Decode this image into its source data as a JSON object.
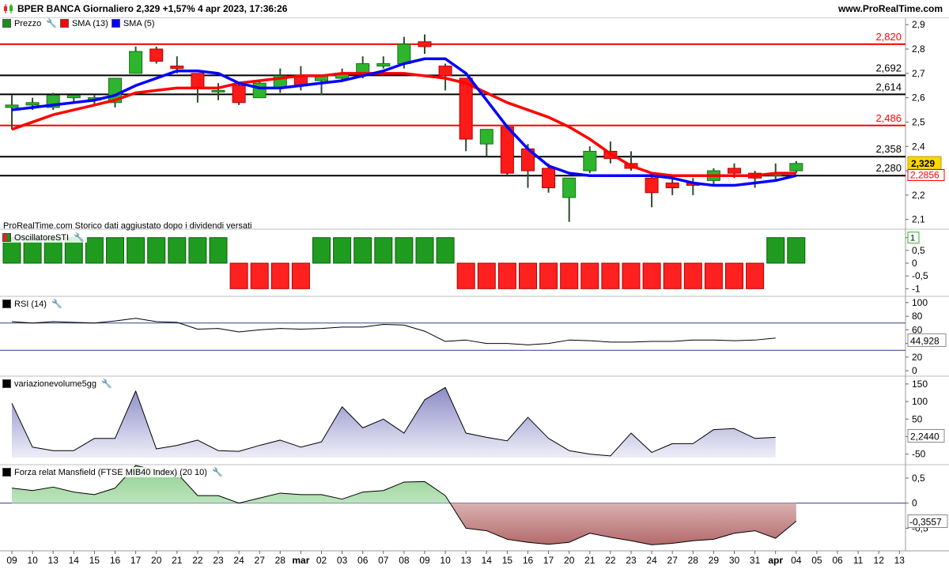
{
  "header": {
    "title": "BPER BANCA Giornaliero 2,329 +1,57% 4 apr 2023, 17:36:26",
    "site": "www.ProRealTime.com"
  },
  "price_panel": {
    "legend": [
      {
        "label": "Prezzo",
        "color": "#1a8f1a"
      },
      {
        "label": "SMA (13)",
        "color": "#ff0000"
      },
      {
        "label": "SMA (5)",
        "color": "#0000ff"
      }
    ],
    "note": "ProRealTime.com Storico dati aggiustato dopo i dividendi versati",
    "y_ticks": [
      "2,9",
      "2,8",
      "2,7",
      "2,6",
      "2,5",
      "2,4",
      "2,3",
      "2,2",
      "2,1"
    ],
    "y_tick_values": [
      2.9,
      2.8,
      2.7,
      2.6,
      2.5,
      2.4,
      2.3,
      2.2,
      2.1
    ],
    "hlines": [
      {
        "value": 2.82,
        "label": "2,820",
        "color": "#ff0000"
      },
      {
        "value": 2.692,
        "label": "2,692",
        "color": "#000000"
      },
      {
        "value": 2.614,
        "label": "2,614",
        "color": "#000000"
      },
      {
        "value": 2.486,
        "label": "2,486",
        "color": "#ff0000"
      },
      {
        "value": 2.358,
        "label": "2,358",
        "color": "#000000"
      },
      {
        "value": 2.28,
        "label": "2,280",
        "color": "#000000"
      }
    ],
    "last_price": "2,329",
    "sma13_last": "2,2856"
  },
  "sti_panel": {
    "label": "OscillatoreSTI",
    "y_ticks": [
      "1",
      "0,5",
      "0",
      "-0,5",
      "-1"
    ],
    "values": [
      1,
      1,
      1,
      1,
      1,
      1,
      1,
      1,
      1,
      1,
      1,
      -1,
      -1,
      -1,
      -1,
      1,
      1,
      1,
      1,
      1,
      1,
      1,
      -1,
      -1,
      -1,
      -1,
      -1,
      -1,
      -1,
      -1,
      -1,
      -1,
      -1,
      -1,
      -1,
      -1,
      -1,
      1,
      1
    ],
    "last": "1"
  },
  "rsi_panel": {
    "label": "RSI (14)",
    "y_ticks": [
      "100",
      "80",
      "60",
      "40",
      "20",
      "0"
    ],
    "values": [
      72,
      70,
      72,
      71,
      70,
      73,
      77,
      72,
      71,
      61,
      62,
      57,
      60,
      62,
      61,
      62,
      64,
      64,
      68,
      67,
      58,
      43,
      45,
      40,
      40,
      38,
      40,
      45,
      44,
      42,
      42,
      43,
      43,
      45,
      45,
      44,
      45,
      48
    ],
    "last": "44,928"
  },
  "vol_panel": {
    "label": "variazionevolume5gg",
    "y_ticks": [
      "150",
      "100",
      "50",
      "0",
      "-50"
    ],
    "values": [
      95,
      -30,
      -40,
      -40,
      -5,
      -5,
      130,
      -35,
      -25,
      -10,
      -40,
      -42,
      -25,
      -10,
      -30,
      -15,
      85,
      25,
      50,
      10,
      105,
      140,
      10,
      -2,
      -12,
      55,
      -5,
      -40,
      -50,
      -55,
      10,
      -45,
      -20,
      -20,
      20,
      23,
      -5,
      -2
    ],
    "last": "2,2440"
  },
  "mansfield_panel": {
    "label": "Forza relat Mansfield (FTSE MIB40 Index) (20 10)",
    "y_ticks": [
      "0,5",
      "0",
      "-0,5"
    ],
    "values": [
      0.3,
      0.25,
      0.32,
      0.22,
      0.17,
      0.3,
      0.75,
      0.65,
      0.6,
      0.15,
      0.15,
      0.0,
      0.1,
      0.2,
      0.17,
      0.17,
      0.08,
      0.22,
      0.25,
      0.42,
      0.43,
      0.15,
      -0.5,
      -0.55,
      -0.72,
      -0.78,
      -0.82,
      -0.78,
      -0.6,
      -0.68,
      -0.75,
      -0.83,
      -0.8,
      -0.75,
      -0.72,
      -0.6,
      -0.55,
      -0.7,
      -0.36
    ],
    "last": "-0,3557"
  },
  "x_axis": {
    "labels": [
      "09",
      "10",
      "13",
      "14",
      "15",
      "16",
      "17",
      "20",
      "21",
      "22",
      "23",
      "24",
      "27",
      "28",
      "mar",
      "02",
      "03",
      "06",
      "07",
      "08",
      "09",
      "10",
      "13",
      "14",
      "15",
      "16",
      "17",
      "20",
      "21",
      "22",
      "23",
      "24",
      "27",
      "28",
      "29",
      "30",
      "31",
      "apr",
      "04",
      "05",
      "06",
      "11",
      "12",
      "13"
    ],
    "bold": [
      "mar",
      "apr"
    ]
  },
  "candles": [
    {
      "o": 2.56,
      "h": 2.61,
      "l": 2.47,
      "c": 2.57
    },
    {
      "o": 2.57,
      "h": 2.6,
      "l": 2.55,
      "c": 2.58
    },
    {
      "o": 2.56,
      "h": 2.62,
      "l": 2.55,
      "c": 2.61
    },
    {
      "o": 2.6,
      "h": 2.61,
      "l": 2.58,
      "c": 2.61
    },
    {
      "o": 2.59,
      "h": 2.61,
      "l": 2.57,
      "c": 2.6
    },
    {
      "o": 2.58,
      "h": 2.68,
      "l": 2.56,
      "c": 2.68
    },
    {
      "o": 2.7,
      "h": 2.81,
      "l": 2.7,
      "c": 2.79
    },
    {
      "o": 2.8,
      "h": 2.81,
      "l": 2.74,
      "c": 2.75
    },
    {
      "o": 2.73,
      "h": 2.77,
      "l": 2.7,
      "c": 2.72
    },
    {
      "o": 2.7,
      "h": 2.7,
      "l": 2.58,
      "c": 2.64
    },
    {
      "o": 2.63,
      "h": 2.66,
      "l": 2.59,
      "c": 2.63
    },
    {
      "o": 2.65,
      "h": 2.66,
      "l": 2.57,
      "c": 2.58
    },
    {
      "o": 2.6,
      "h": 2.67,
      "l": 2.6,
      "c": 2.66
    },
    {
      "o": 2.64,
      "h": 2.72,
      "l": 2.62,
      "c": 2.69
    },
    {
      "o": 2.69,
      "h": 2.73,
      "l": 2.63,
      "c": 2.65
    },
    {
      "o": 2.67,
      "h": 2.69,
      "l": 2.61,
      "c": 2.69
    },
    {
      "o": 2.68,
      "h": 2.72,
      "l": 2.67,
      "c": 2.7
    },
    {
      "o": 2.7,
      "h": 2.77,
      "l": 2.68,
      "c": 2.74
    },
    {
      "o": 2.73,
      "h": 2.77,
      "l": 2.72,
      "c": 2.74
    },
    {
      "o": 2.74,
      "h": 2.85,
      "l": 2.72,
      "c": 2.82
    },
    {
      "o": 2.83,
      "h": 2.86,
      "l": 2.78,
      "c": 2.81
    },
    {
      "o": 2.73,
      "h": 2.74,
      "l": 2.63,
      "c": 2.69
    },
    {
      "o": 2.68,
      "h": 2.68,
      "l": 2.38,
      "c": 2.43
    },
    {
      "o": 2.41,
      "h": 2.47,
      "l": 2.36,
      "c": 2.47
    },
    {
      "o": 2.48,
      "h": 2.49,
      "l": 2.28,
      "c": 2.29
    },
    {
      "o": 2.39,
      "h": 2.41,
      "l": 2.23,
      "c": 2.3
    },
    {
      "o": 2.31,
      "h": 2.33,
      "l": 2.21,
      "c": 2.23
    },
    {
      "o": 2.19,
      "h": 2.26,
      "l": 2.09,
      "c": 2.27
    },
    {
      "o": 2.3,
      "h": 2.4,
      "l": 2.29,
      "c": 2.38
    },
    {
      "o": 2.38,
      "h": 2.42,
      "l": 2.33,
      "c": 2.35
    },
    {
      "o": 2.33,
      "h": 2.38,
      "l": 2.3,
      "c": 2.31
    },
    {
      "o": 2.27,
      "h": 2.28,
      "l": 2.15,
      "c": 2.21
    },
    {
      "o": 2.25,
      "h": 2.27,
      "l": 2.2,
      "c": 2.23
    },
    {
      "o": 2.25,
      "h": 2.27,
      "l": 2.2,
      "c": 2.24
    },
    {
      "o": 2.26,
      "h": 2.31,
      "l": 2.24,
      "c": 2.3
    },
    {
      "o": 2.31,
      "h": 2.33,
      "l": 2.27,
      "c": 2.29
    },
    {
      "o": 2.29,
      "h": 2.3,
      "l": 2.23,
      "c": 2.27
    },
    {
      "o": 2.28,
      "h": 2.33,
      "l": 2.26,
      "c": 2.29
    },
    {
      "o": 2.3,
      "h": 2.34,
      "l": 2.29,
      "c": 2.33
    }
  ],
  "sma13": [
    2.47,
    2.5,
    2.53,
    2.55,
    2.57,
    2.59,
    2.62,
    2.63,
    2.64,
    2.64,
    2.64,
    2.66,
    2.67,
    2.68,
    2.69,
    2.69,
    2.7,
    2.7,
    2.7,
    2.7,
    2.69,
    2.68,
    2.66,
    2.62,
    2.58,
    2.55,
    2.52,
    2.48,
    2.43,
    2.37,
    2.32,
    2.29,
    2.28,
    2.28,
    2.28,
    2.28,
    2.28,
    2.29,
    2.29
  ],
  "sma5": [
    2.55,
    2.56,
    2.57,
    2.58,
    2.59,
    2.61,
    2.65,
    2.68,
    2.71,
    2.71,
    2.7,
    2.66,
    2.64,
    2.64,
    2.65,
    2.66,
    2.67,
    2.69,
    2.71,
    2.74,
    2.76,
    2.76,
    2.7,
    2.59,
    2.48,
    2.39,
    2.32,
    2.29,
    2.28,
    2.28,
    2.28,
    2.28,
    2.27,
    2.25,
    2.24,
    2.24,
    2.25,
    2.26,
    2.28
  ]
}
